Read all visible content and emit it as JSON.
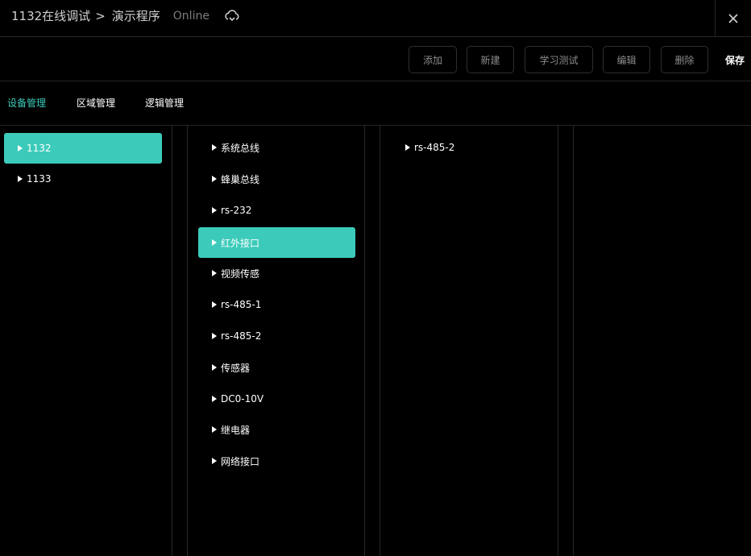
{
  "header": {
    "breadcrumb_root": "1132在线调试",
    "breadcrumb_separator": ">",
    "breadcrumb_current": "演示程序",
    "status": "Online"
  },
  "toolbar": {
    "add_label": "添加",
    "new_label": "新建",
    "learn_test_label": "学习测试",
    "edit_label": "编辑",
    "delete_label": "删除",
    "save_label": "保存"
  },
  "tabs": [
    {
      "label": "设备管理",
      "active": true
    },
    {
      "label": "区域管理",
      "active": false
    },
    {
      "label": "逻辑管理",
      "active": false
    }
  ],
  "columns": {
    "devices": [
      {
        "label": "1132",
        "selected": true
      },
      {
        "label": "1133",
        "selected": false
      }
    ],
    "interfaces": [
      {
        "label": "系统总线",
        "selected": false
      },
      {
        "label": "蜂巢总线",
        "selected": false
      },
      {
        "label": "rs-232",
        "selected": false
      },
      {
        "label": "红外接口",
        "selected": true
      },
      {
        "label": "视频传感",
        "selected": false
      },
      {
        "label": "rs-485-1",
        "selected": false
      },
      {
        "label": "rs-485-2",
        "selected": false
      },
      {
        "label": "传感器",
        "selected": false
      },
      {
        "label": "DC0-10V",
        "selected": false
      },
      {
        "label": "继电器",
        "selected": false
      },
      {
        "label": "网络接口",
        "selected": false
      }
    ],
    "subitems": [
      {
        "label": "rs-485-2",
        "selected": false
      }
    ]
  },
  "colors": {
    "accent": "#3ccbbb",
    "background": "#000000",
    "border": "#262626"
  }
}
